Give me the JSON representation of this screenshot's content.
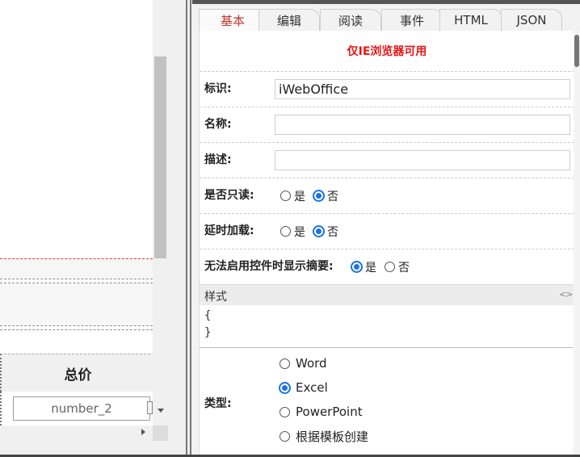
{
  "left_canvas": {
    "total_header": "总价",
    "number_field": "number_2"
  },
  "tabs": [
    {
      "label": "基本",
      "active": true
    },
    {
      "label": "编辑",
      "active": false
    },
    {
      "label": "阅读",
      "active": false
    },
    {
      "label": "事件",
      "active": false
    },
    {
      "label": "HTML",
      "active": false
    },
    {
      "label": "JSON",
      "active": false
    }
  ],
  "panel": {
    "warning": "仅IE浏览器可用",
    "id_label": "标识:",
    "id_value": "iWebOffice",
    "name_label": "名称:",
    "name_value": "",
    "desc_label": "描述:",
    "desc_value": "",
    "readonly_label": "是否只读:",
    "readonly_value": "否",
    "lazy_label": "延时加载:",
    "lazy_value": "否",
    "summary_label": "无法启用控件时显示摘要:",
    "summary_value": "是",
    "yes": "是",
    "no": "否",
    "style_title": "样式",
    "style_toggle": "<>",
    "style_open": "{",
    "style_close": "}",
    "type_label": "类型:",
    "type_options": [
      "Word",
      "Excel",
      "PowerPoint",
      "根据模板创建"
    ],
    "type_selected": "Excel"
  },
  "colors": {
    "warning": "#e81515",
    "active_tab_text": "#c0392b",
    "radio_checked": "#1a73e8"
  }
}
